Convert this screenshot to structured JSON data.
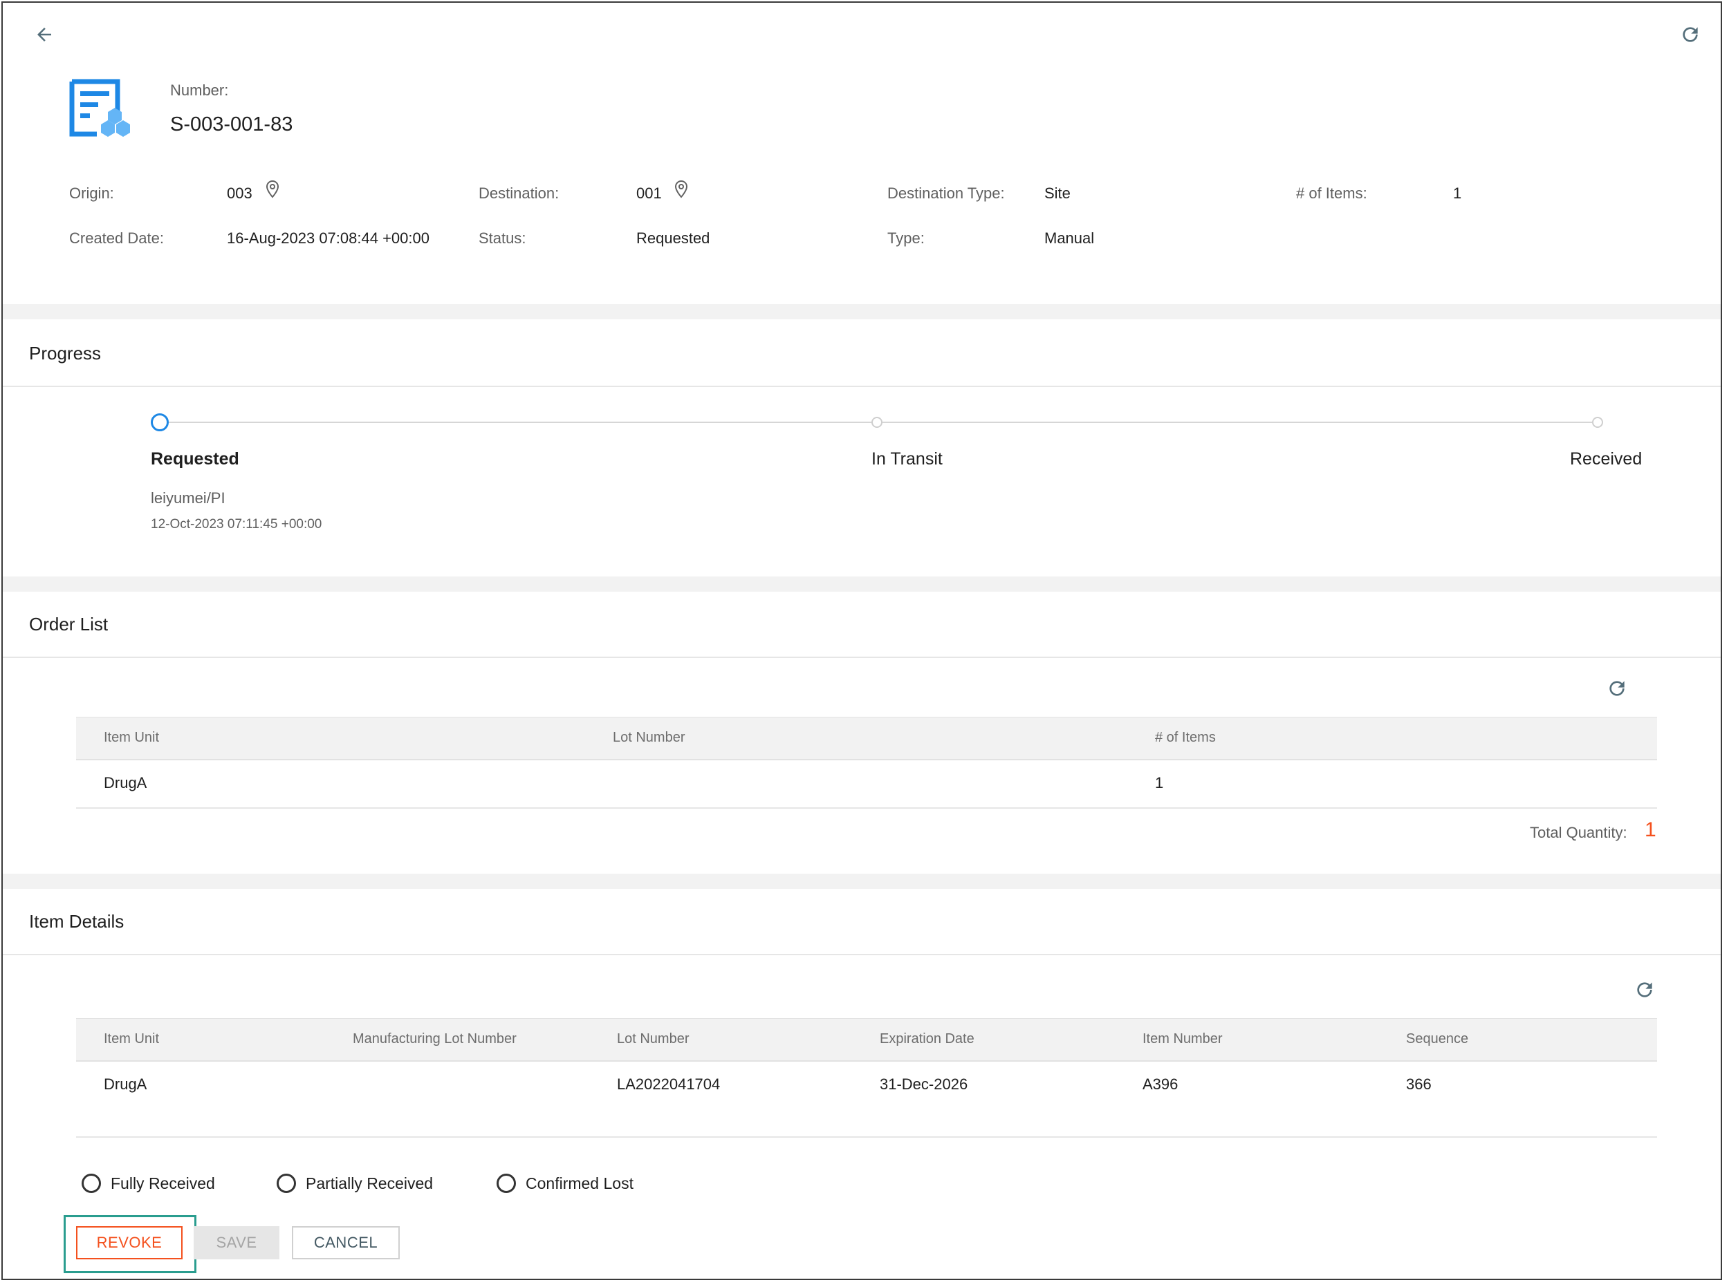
{
  "header": {
    "number_label": "Number:",
    "number_value": "S-003-001-83",
    "fields": {
      "origin_label": "Origin:",
      "origin_value": "003",
      "destination_label": "Destination:",
      "destination_value": "001",
      "destination_type_label": "Destination Type:",
      "destination_type_value": "Site",
      "items_label": "# of Items:",
      "items_value": "1",
      "created_label": "Created Date:",
      "created_value": "16-Aug-2023 07:08:44 +00:00",
      "status_label": "Status:",
      "status_value": "Requested",
      "type_label": "Type:",
      "type_value": "Manual"
    }
  },
  "progress": {
    "title": "Progress",
    "steps": [
      {
        "label": "Requested",
        "user": "leiyumei/PI",
        "timestamp": "12-Oct-2023 07:11:45 +00:00"
      },
      {
        "label": "In Transit"
      },
      {
        "label": "Received"
      }
    ]
  },
  "order_list": {
    "title": "Order List",
    "columns": [
      "Item Unit",
      "Lot Number",
      "# of Items"
    ],
    "rows": [
      [
        "DrugA",
        "",
        "1"
      ]
    ],
    "total_label": "Total Quantity:",
    "total_value": "1"
  },
  "item_details": {
    "title": "Item Details",
    "columns": [
      "Item Unit",
      "Manufacturing Lot Number",
      "Lot Number",
      "Expiration Date",
      "Item Number",
      "Sequence"
    ],
    "rows": [
      [
        "DrugA",
        "",
        "LA2022041704",
        "31-Dec-2026",
        "A396",
        "366"
      ]
    ]
  },
  "receipt_options": [
    "Fully Received",
    "Partially Received",
    "Confirmed Lost"
  ],
  "actions": {
    "revoke_label": "REVOKE",
    "save_label": "SAVE",
    "cancel_label": "CANCEL"
  },
  "colors": {
    "accent_blue": "#1e88e5",
    "logo_light_blue": "#64b5f6",
    "danger": "#f4511e",
    "highlight_teal": "#2a9d8f",
    "icon_gray": "#546e7a"
  },
  "icons": [
    "back-arrow-icon",
    "refresh-icon",
    "shipment-document-icon",
    "location-pin-icon"
  ]
}
